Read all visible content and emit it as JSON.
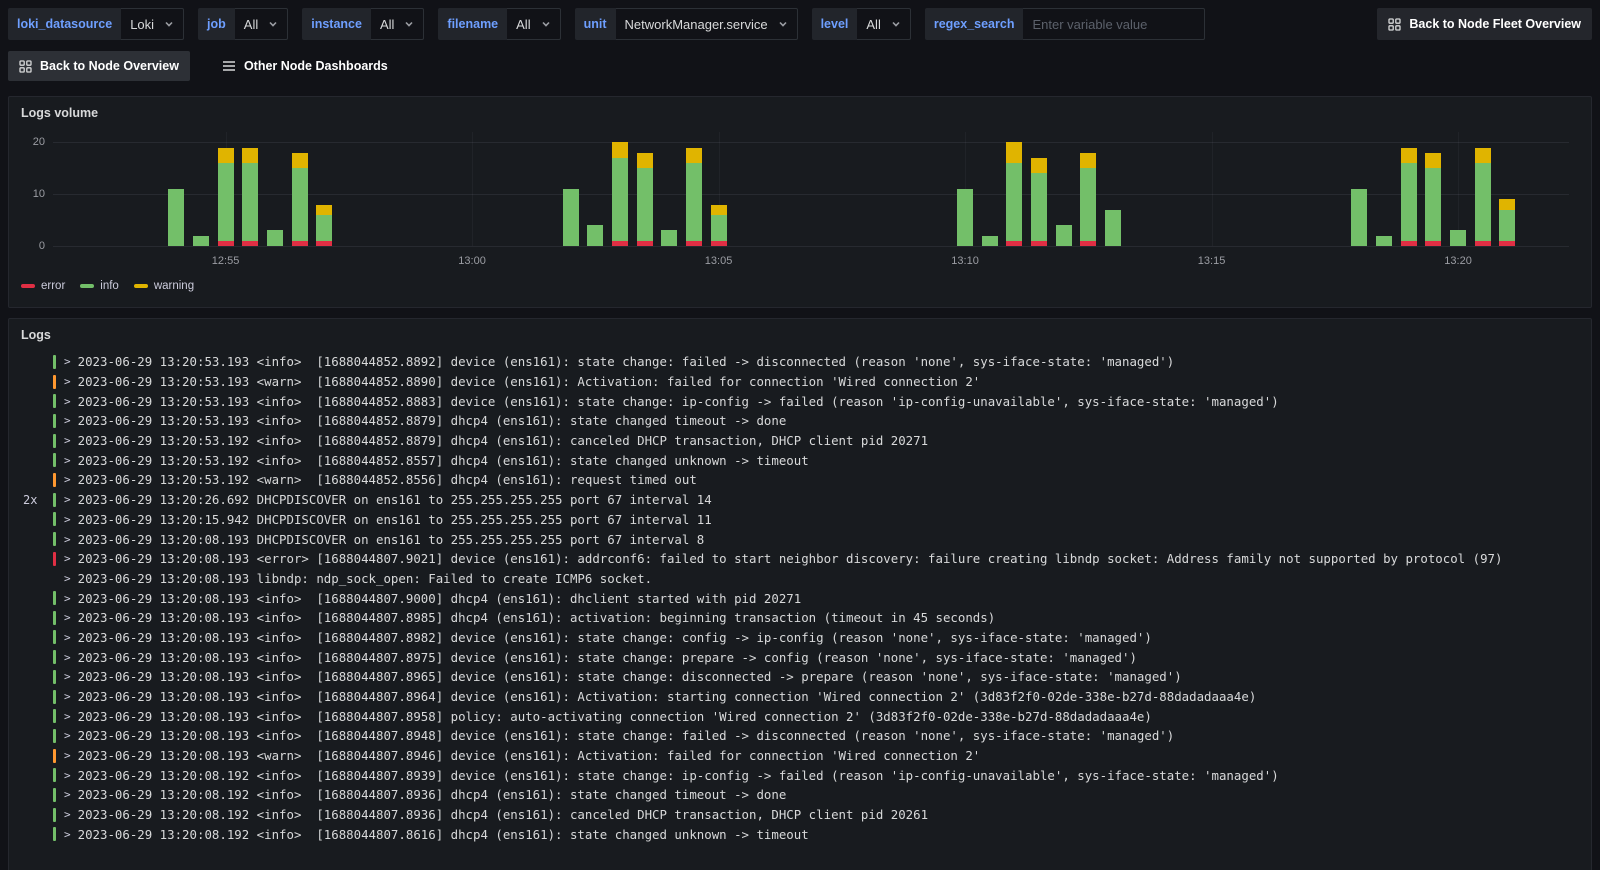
{
  "toolbar": {
    "variables": [
      {
        "name": "loki_datasource",
        "label": "loki_datasource",
        "value": "Loki",
        "type": "select"
      },
      {
        "name": "job",
        "label": "job",
        "value": "All",
        "type": "select"
      },
      {
        "name": "instance",
        "label": "instance",
        "value": "All",
        "type": "select"
      },
      {
        "name": "filename",
        "label": "filename",
        "value": "All",
        "type": "select"
      },
      {
        "name": "unit",
        "label": "unit",
        "value": "NetworkManager.service",
        "type": "select"
      },
      {
        "name": "level",
        "label": "level",
        "value": "All",
        "type": "select"
      },
      {
        "name": "regex_search",
        "label": "regex_search",
        "value": "",
        "placeholder": "Enter variable value",
        "type": "input"
      }
    ],
    "fleet_button": "Back to Node Fleet Overview"
  },
  "nav": {
    "back_button": "Back to Node Overview",
    "other_dashboards": "Other Node Dashboards"
  },
  "volume_panel": {
    "title": "Logs volume"
  },
  "chart_data": {
    "type": "bar",
    "stacked": true,
    "title": "Logs volume",
    "bucket_seconds": 30,
    "x_domain": [
      "12:51:30",
      "13:22:15"
    ],
    "ylim": [
      0,
      22
    ],
    "y_ticks": [
      0,
      10,
      20
    ],
    "x_ticks": [
      {
        "label": "12:55",
        "time": "12:55:00"
      },
      {
        "label": "13:00",
        "time": "13:00:00"
      },
      {
        "label": "13:05",
        "time": "13:05:00"
      },
      {
        "label": "13:10",
        "time": "13:10:00"
      },
      {
        "label": "13:15",
        "time": "13:15:00"
      },
      {
        "label": "13:20",
        "time": "13:20:00"
      }
    ],
    "series": [
      {
        "name": "error",
        "color": "#e02f44"
      },
      {
        "name": "info",
        "color": "#73bf69"
      },
      {
        "name": "warning",
        "color": "#e0b400"
      }
    ],
    "bars": [
      {
        "time": "12:54:00",
        "error": 0,
        "info": 11,
        "warning": 0
      },
      {
        "time": "12:54:30",
        "error": 0,
        "info": 2,
        "warning": 0
      },
      {
        "time": "12:55:00",
        "error": 1,
        "info": 15,
        "warning": 3
      },
      {
        "time": "12:55:30",
        "error": 1,
        "info": 15,
        "warning": 3
      },
      {
        "time": "12:56:00",
        "error": 0,
        "info": 3,
        "warning": 0
      },
      {
        "time": "12:56:30",
        "error": 1,
        "info": 14,
        "warning": 3
      },
      {
        "time": "12:57:00",
        "error": 1,
        "info": 5,
        "warning": 2
      },
      {
        "time": "13:02:00",
        "error": 0,
        "info": 11,
        "warning": 0
      },
      {
        "time": "13:02:30",
        "error": 0,
        "info": 4,
        "warning": 0
      },
      {
        "time": "13:03:00",
        "error": 1,
        "info": 16,
        "warning": 3
      },
      {
        "time": "13:03:30",
        "error": 1,
        "info": 14,
        "warning": 3
      },
      {
        "time": "13:04:00",
        "error": 0,
        "info": 3,
        "warning": 0
      },
      {
        "time": "13:04:30",
        "error": 1,
        "info": 15,
        "warning": 3
      },
      {
        "time": "13:05:00",
        "error": 1,
        "info": 5,
        "warning": 2
      },
      {
        "time": "13:10:00",
        "error": 0,
        "info": 11,
        "warning": 0
      },
      {
        "time": "13:10:30",
        "error": 0,
        "info": 2,
        "warning": 0
      },
      {
        "time": "13:11:00",
        "error": 1,
        "info": 15,
        "warning": 4
      },
      {
        "time": "13:11:30",
        "error": 1,
        "info": 13,
        "warning": 3
      },
      {
        "time": "13:12:00",
        "error": 0,
        "info": 4,
        "warning": 0
      },
      {
        "time": "13:12:30",
        "error": 1,
        "info": 14,
        "warning": 3
      },
      {
        "time": "13:13:00",
        "error": 0,
        "info": 7,
        "warning": 0
      },
      {
        "time": "13:18:00",
        "error": 0,
        "info": 11,
        "warning": 0
      },
      {
        "time": "13:18:30",
        "error": 0,
        "info": 2,
        "warning": 0
      },
      {
        "time": "13:19:00",
        "error": 1,
        "info": 15,
        "warning": 3
      },
      {
        "time": "13:19:30",
        "error": 1,
        "info": 14,
        "warning": 3
      },
      {
        "time": "13:20:00",
        "error": 0,
        "info": 3,
        "warning": 0
      },
      {
        "time": "13:20:30",
        "error": 1,
        "info": 15,
        "warning": 3
      },
      {
        "time": "13:21:00",
        "error": 1,
        "info": 6,
        "warning": 2
      }
    ],
    "legend_position": "bottom"
  },
  "logs_panel": {
    "title": "Logs",
    "level_colors": {
      "info": "#73bf69",
      "warn": "#ff9830",
      "error": "#e02f44"
    },
    "rows": [
      {
        "count": "",
        "level": "info",
        "text": "2023-06-29 13:20:53.193 <info>  [1688044852.8892] device (ens161): state change: failed -> disconnected (reason 'none', sys-iface-state: 'managed')"
      },
      {
        "count": "",
        "level": "warn",
        "text": "2023-06-29 13:20:53.193 <warn>  [1688044852.8890] device (ens161): Activation: failed for connection 'Wired connection 2'"
      },
      {
        "count": "",
        "level": "info",
        "text": "2023-06-29 13:20:53.193 <info>  [1688044852.8883] device (ens161): state change: ip-config -> failed (reason 'ip-config-unavailable', sys-iface-state: 'managed')"
      },
      {
        "count": "",
        "level": "info",
        "text": "2023-06-29 13:20:53.193 <info>  [1688044852.8879] dhcp4 (ens161): state changed timeout -> done"
      },
      {
        "count": "",
        "level": "info",
        "text": "2023-06-29 13:20:53.192 <info>  [1688044852.8879] dhcp4 (ens161): canceled DHCP transaction, DHCP client pid 20271"
      },
      {
        "count": "",
        "level": "info",
        "text": "2023-06-29 13:20:53.192 <info>  [1688044852.8557] dhcp4 (ens161): state changed unknown -> timeout"
      },
      {
        "count": "",
        "level": "warn",
        "text": "2023-06-29 13:20:53.192 <warn>  [1688044852.8556] dhcp4 (ens161): request timed out"
      },
      {
        "count": "2x",
        "level": "info",
        "text": "2023-06-29 13:20:26.692 DHCPDISCOVER on ens161 to 255.255.255.255 port 67 interval 14"
      },
      {
        "count": "",
        "level": "info",
        "text": "2023-06-29 13:20:15.942 DHCPDISCOVER on ens161 to 255.255.255.255 port 67 interval 11"
      },
      {
        "count": "",
        "level": "info",
        "text": "2023-06-29 13:20:08.193 DHCPDISCOVER on ens161 to 255.255.255.255 port 67 interval 8"
      },
      {
        "count": "",
        "level": "error",
        "text": "2023-06-29 13:20:08.193 <error> [1688044807.9021] device (ens161): addrconf6: failed to start neighbor discovery: failure creating libndp socket: Address family not supported by protocol (97)"
      },
      {
        "count": "",
        "level": "",
        "text": "2023-06-29 13:20:08.193 libndp: ndp_sock_open: Failed to create ICMP6 socket."
      },
      {
        "count": "",
        "level": "info",
        "text": "2023-06-29 13:20:08.193 <info>  [1688044807.9000] dhcp4 (ens161): dhclient started with pid 20271"
      },
      {
        "count": "",
        "level": "info",
        "text": "2023-06-29 13:20:08.193 <info>  [1688044807.8985] dhcp4 (ens161): activation: beginning transaction (timeout in 45 seconds)"
      },
      {
        "count": "",
        "level": "info",
        "text": "2023-06-29 13:20:08.193 <info>  [1688044807.8982] device (ens161): state change: config -> ip-config (reason 'none', sys-iface-state: 'managed')"
      },
      {
        "count": "",
        "level": "info",
        "text": "2023-06-29 13:20:08.193 <info>  [1688044807.8975] device (ens161): state change: prepare -> config (reason 'none', sys-iface-state: 'managed')"
      },
      {
        "count": "",
        "level": "info",
        "text": "2023-06-29 13:20:08.193 <info>  [1688044807.8965] device (ens161): state change: disconnected -> prepare (reason 'none', sys-iface-state: 'managed')"
      },
      {
        "count": "",
        "level": "info",
        "text": "2023-06-29 13:20:08.193 <info>  [1688044807.8964] device (ens161): Activation: starting connection 'Wired connection 2' (3d83f2f0-02de-338e-b27d-88dadadaaa4e)"
      },
      {
        "count": "",
        "level": "info",
        "text": "2023-06-29 13:20:08.193 <info>  [1688044807.8958] policy: auto-activating connection 'Wired connection 2' (3d83f2f0-02de-338e-b27d-88dadadaaa4e)"
      },
      {
        "count": "",
        "level": "info",
        "text": "2023-06-29 13:20:08.193 <info>  [1688044807.8948] device (ens161): state change: failed -> disconnected (reason 'none', sys-iface-state: 'managed')"
      },
      {
        "count": "",
        "level": "warn",
        "text": "2023-06-29 13:20:08.193 <warn>  [1688044807.8946] device (ens161): Activation: failed for connection 'Wired connection 2'"
      },
      {
        "count": "",
        "level": "info",
        "text": "2023-06-29 13:20:08.192 <info>  [1688044807.8939] device (ens161): state change: ip-config -> failed (reason 'ip-config-unavailable', sys-iface-state: 'managed')"
      },
      {
        "count": "",
        "level": "info",
        "text": "2023-06-29 13:20:08.192 <info>  [1688044807.8936] dhcp4 (ens161): state changed timeout -> done"
      },
      {
        "count": "",
        "level": "info",
        "text": "2023-06-29 13:20:08.192 <info>  [1688044807.8936] dhcp4 (ens161): canceled DHCP transaction, DHCP client pid 20261"
      },
      {
        "count": "",
        "level": "info",
        "text": "2023-06-29 13:20:08.192 <info>  [1688044807.8616] dhcp4 (ens161): state changed unknown -> timeout"
      }
    ]
  }
}
